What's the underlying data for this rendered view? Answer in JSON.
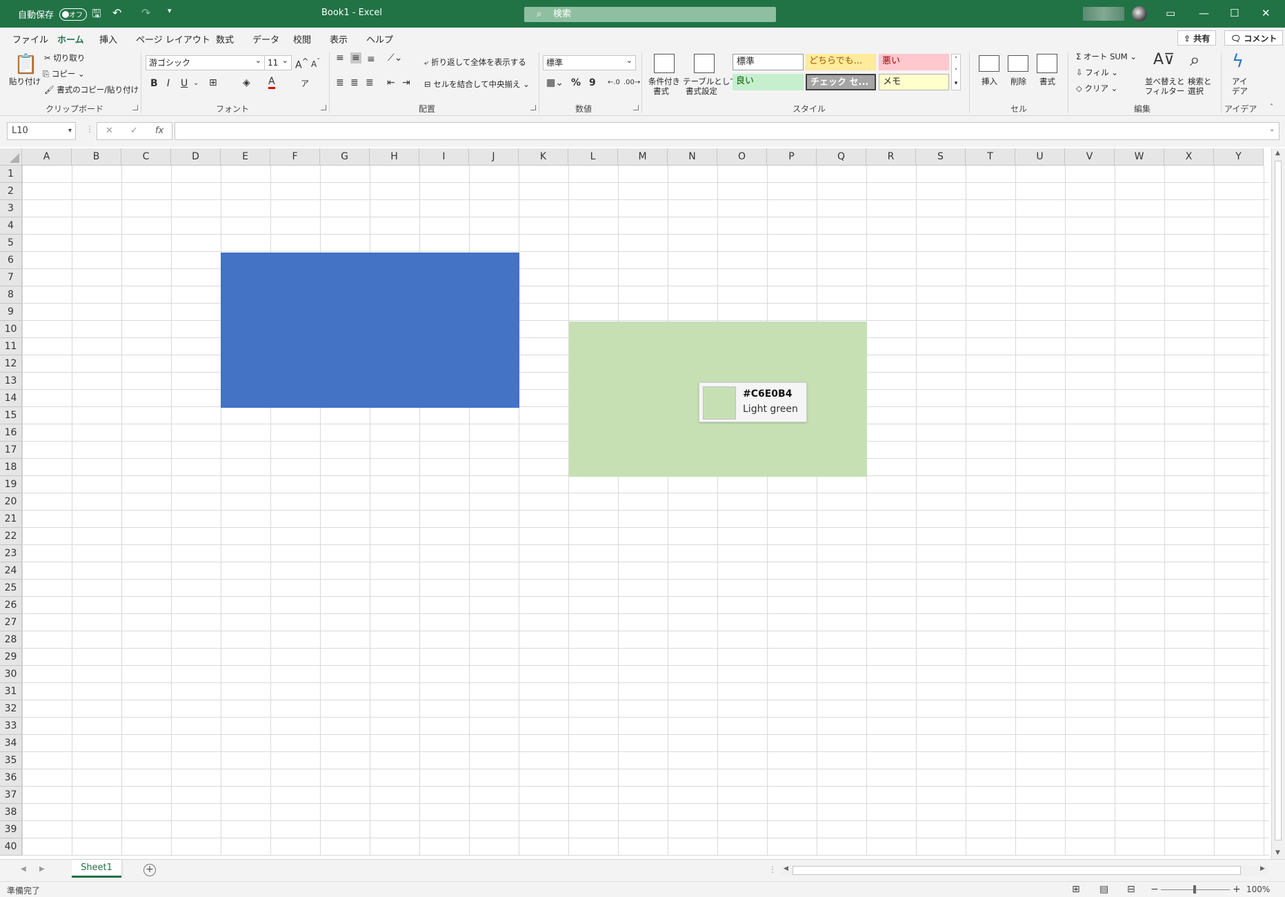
{
  "titlebar": {
    "autosave_label": "自動保存",
    "autosave_state": "オフ",
    "document_title": "Book1  -  Excel",
    "search_placeholder": "検索"
  },
  "tabs": [
    {
      "label": "ファイル",
      "active": false
    },
    {
      "label": "ホーム",
      "active": true
    },
    {
      "label": "挿入",
      "active": false
    },
    {
      "label": "ページ レイアウト",
      "active": false
    },
    {
      "label": "数式",
      "active": false
    },
    {
      "label": "データ",
      "active": false
    },
    {
      "label": "校閲",
      "active": false
    },
    {
      "label": "表示",
      "active": false
    },
    {
      "label": "ヘルプ",
      "active": false
    }
  ],
  "share": {
    "share_label": "共有",
    "comment_label": "コメント"
  },
  "ribbon": {
    "clipboard": {
      "paste": "貼り付け",
      "cut": "切り取り",
      "copy": "コピー",
      "format_painter": "書式のコピー/貼り付け",
      "group": "クリップボード"
    },
    "font": {
      "font_name": "游ゴシック",
      "font_size": "11",
      "group": "フォント"
    },
    "alignment": {
      "wrap_text": "折り返して全体を表示する",
      "merge_center": "セルを結合して中央揃え",
      "group": "配置"
    },
    "number": {
      "format": "標準",
      "group": "数値"
    },
    "styles": {
      "conditional": "条件付き",
      "conditional2": "書式",
      "table": "テーブルとして",
      "table2": "書式設定",
      "standard": "標準",
      "neutral": "どちらでも...",
      "bad": "悪い",
      "good": "良い",
      "check": "チェック セ...",
      "memo": "メモ",
      "group": "スタイル"
    },
    "cells": {
      "insert": "挿入",
      "delete": "削除",
      "format": "書式",
      "group": "セル"
    },
    "editing": {
      "autosum": "オート SUM",
      "fill": "フィル",
      "clear": "クリア",
      "sort": "並べ替えと",
      "sort2": "フィルター",
      "find": "検索と",
      "find2": "選択",
      "group": "編集"
    },
    "ideas": {
      "label1": "アイ",
      "label2": "デア",
      "group": "アイデア"
    }
  },
  "formula_bar": {
    "name_box": "L10",
    "fx": "fx",
    "value": ""
  },
  "columns": [
    "A",
    "B",
    "C",
    "D",
    "E",
    "F",
    "G",
    "H",
    "I",
    "J",
    "K",
    "L",
    "M",
    "N",
    "O",
    "P",
    "Q",
    "R",
    "S",
    "T",
    "U",
    "V",
    "W",
    "X",
    "Y"
  ],
  "rows": [
    "1",
    "2",
    "3",
    "4",
    "5",
    "6",
    "7",
    "8",
    "9",
    "10",
    "11",
    "12",
    "13",
    "14",
    "15",
    "16",
    "17",
    "18",
    "19",
    "20",
    "21",
    "22",
    "23",
    "24",
    "25",
    "26",
    "27",
    "28",
    "29",
    "30",
    "31",
    "32",
    "33",
    "34",
    "35",
    "36",
    "37",
    "38",
    "39",
    "40"
  ],
  "shapes": {
    "blue_color": "#4472C4",
    "green_color": "#C6E0B4"
  },
  "tooltip": {
    "hex": "#C6E0B4",
    "name": "Light green",
    "swatch_color": "#C6E0B4"
  },
  "sheets": {
    "active": "Sheet1"
  },
  "status": {
    "ready": "準備完了",
    "zoom": "100%"
  }
}
